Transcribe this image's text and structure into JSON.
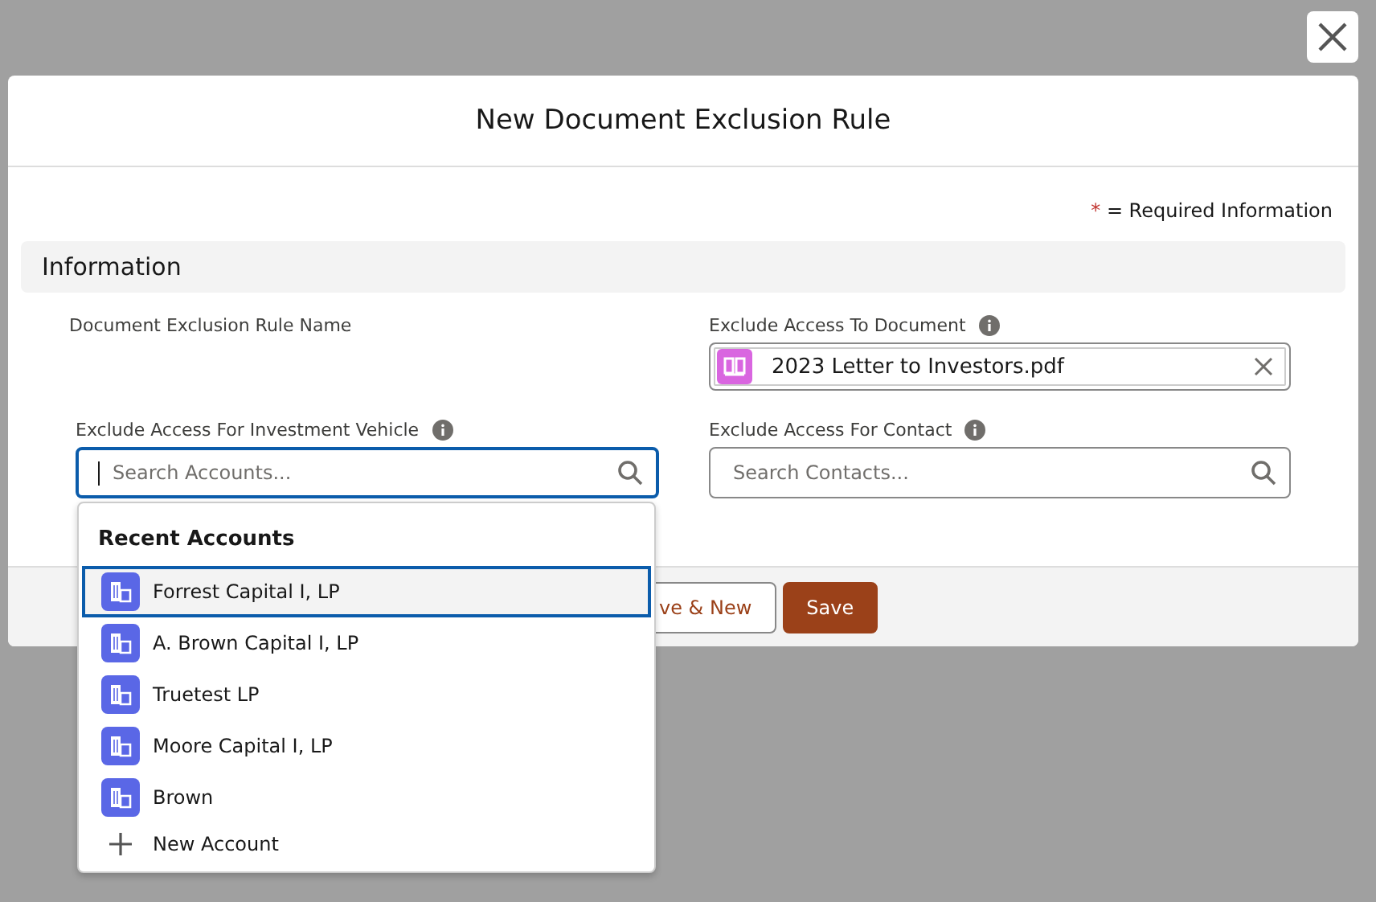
{
  "modal": {
    "title": "New Document Exclusion Rule",
    "required": {
      "mark": "*",
      "text": "= Required Information"
    },
    "section": "Information"
  },
  "fields": [
    {
      "kind": "text",
      "label": "Document Exclusion Rule Name",
      "info": false
    },
    {
      "kind": "pill",
      "label": "Exclude Access To Document",
      "info": true,
      "value": "2023 Letter to Investors.pdf"
    },
    {
      "kind": "search",
      "label": "Exclude Access For Investment Vehicle",
      "info": true,
      "placeholder": "Search Accounts...",
      "focused": true
    },
    {
      "kind": "search",
      "label": "Exclude Access For Contact",
      "info": true,
      "placeholder": "Search Contacts...",
      "focused": false
    }
  ],
  "dropdown": {
    "heading": "Recent Accounts",
    "items": [
      {
        "label": "Forrest Capital I, LP",
        "selected": true
      },
      {
        "label": "A. Brown Capital I, LP",
        "selected": false
      },
      {
        "label": "Truetest LP",
        "selected": false
      },
      {
        "label": "Moore Capital I, LP",
        "selected": false
      },
      {
        "label": "Brown",
        "selected": false
      }
    ],
    "action": "New Account"
  },
  "buttons": [
    {
      "label": "ve & New",
      "kind": "neutral"
    },
    {
      "label": "Save",
      "kind": "brand"
    }
  ]
}
